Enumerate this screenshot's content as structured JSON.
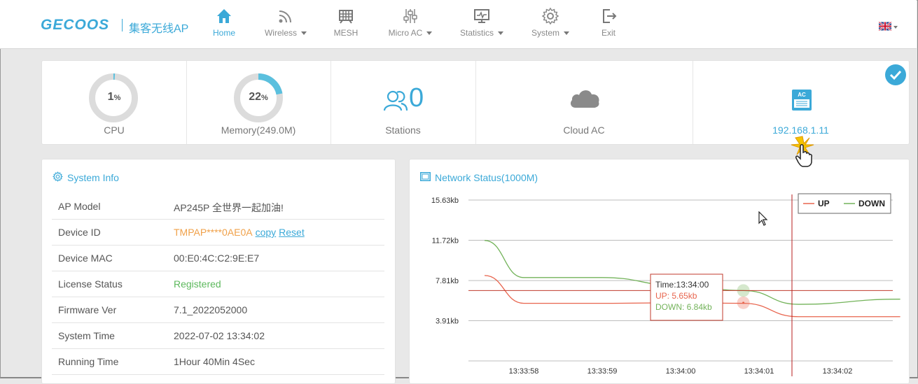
{
  "brand": {
    "logo": "GECOOS",
    "subtitle": "集客无线AP"
  },
  "nav": {
    "home": "Home",
    "wireless": "Wireless",
    "mesh": "MESH",
    "micro_ac": "Micro AC",
    "statistics": "Statistics",
    "system": "System",
    "exit": "Exit",
    "active": "Home"
  },
  "language": {
    "flag": "uk-flag-icon"
  },
  "stats": {
    "cpu": {
      "value": "1",
      "unit": "%",
      "label": "CPU",
      "percent": 1
    },
    "memory": {
      "value": "22",
      "unit": "%",
      "label": "Memory(249.0M)",
      "percent": 22
    },
    "stations": {
      "value": "0",
      "label": "Stations"
    },
    "cloud": {
      "label": "Cloud AC"
    },
    "ac": {
      "icon_text": "AC",
      "label": "192.168.1.11"
    }
  },
  "system_info": {
    "title": "System Info",
    "rows": [
      {
        "key": "AP Model",
        "value": "AP245P 全世界一起加油!"
      },
      {
        "key": "Device ID",
        "value": "TMPAP****0AE0A",
        "copy": "copy",
        "reset": "Reset"
      },
      {
        "key": "Device MAC",
        "value": "00:E0:4C:C2:9E:E7"
      },
      {
        "key": "License Status",
        "value": "Registered"
      },
      {
        "key": "Firmware Ver",
        "value": "7.1_2022052000"
      },
      {
        "key": "System Time",
        "value": "2022-07-02 13:34:02"
      },
      {
        "key": "Running Time",
        "value": "1Hour 40Min 4Sec"
      }
    ]
  },
  "network_status": {
    "title": "Network Status(1000M)",
    "tooltip": {
      "time": "Time:13:34:00",
      "up": "UP: 5.65kb",
      "down": "DOWN: 6.84kb"
    }
  },
  "colors": {
    "accent": "#3ba9d8",
    "up": "#e8644d",
    "down": "#73b35a"
  },
  "chart_data": {
    "type": "line",
    "x": [
      "13:33:57.5",
      "13:33:58",
      "13:33:59",
      "13:34:00",
      "13:34:01",
      "13:34:02",
      "13:34:02.8"
    ],
    "xticks": [
      "13:33:58",
      "13:33:59",
      "13:34:00",
      "13:34:01",
      "13:34:02"
    ],
    "yticks": [
      "15.63kb",
      "11.72kb",
      "7.81kb",
      "3.91kb"
    ],
    "ylim": [
      0,
      15.63
    ],
    "series": [
      {
        "name": "UP",
        "color": "#e8644d",
        "values": [
          8.3,
          5.6,
          5.6,
          5.65,
          5.6,
          4.3,
          4.3
        ]
      },
      {
        "name": "DOWN",
        "color": "#73b35a",
        "values": [
          11.7,
          8.1,
          8.1,
          7.3,
          6.84,
          5.5,
          6.0
        ]
      }
    ],
    "legend": "top-right",
    "grid": true
  }
}
